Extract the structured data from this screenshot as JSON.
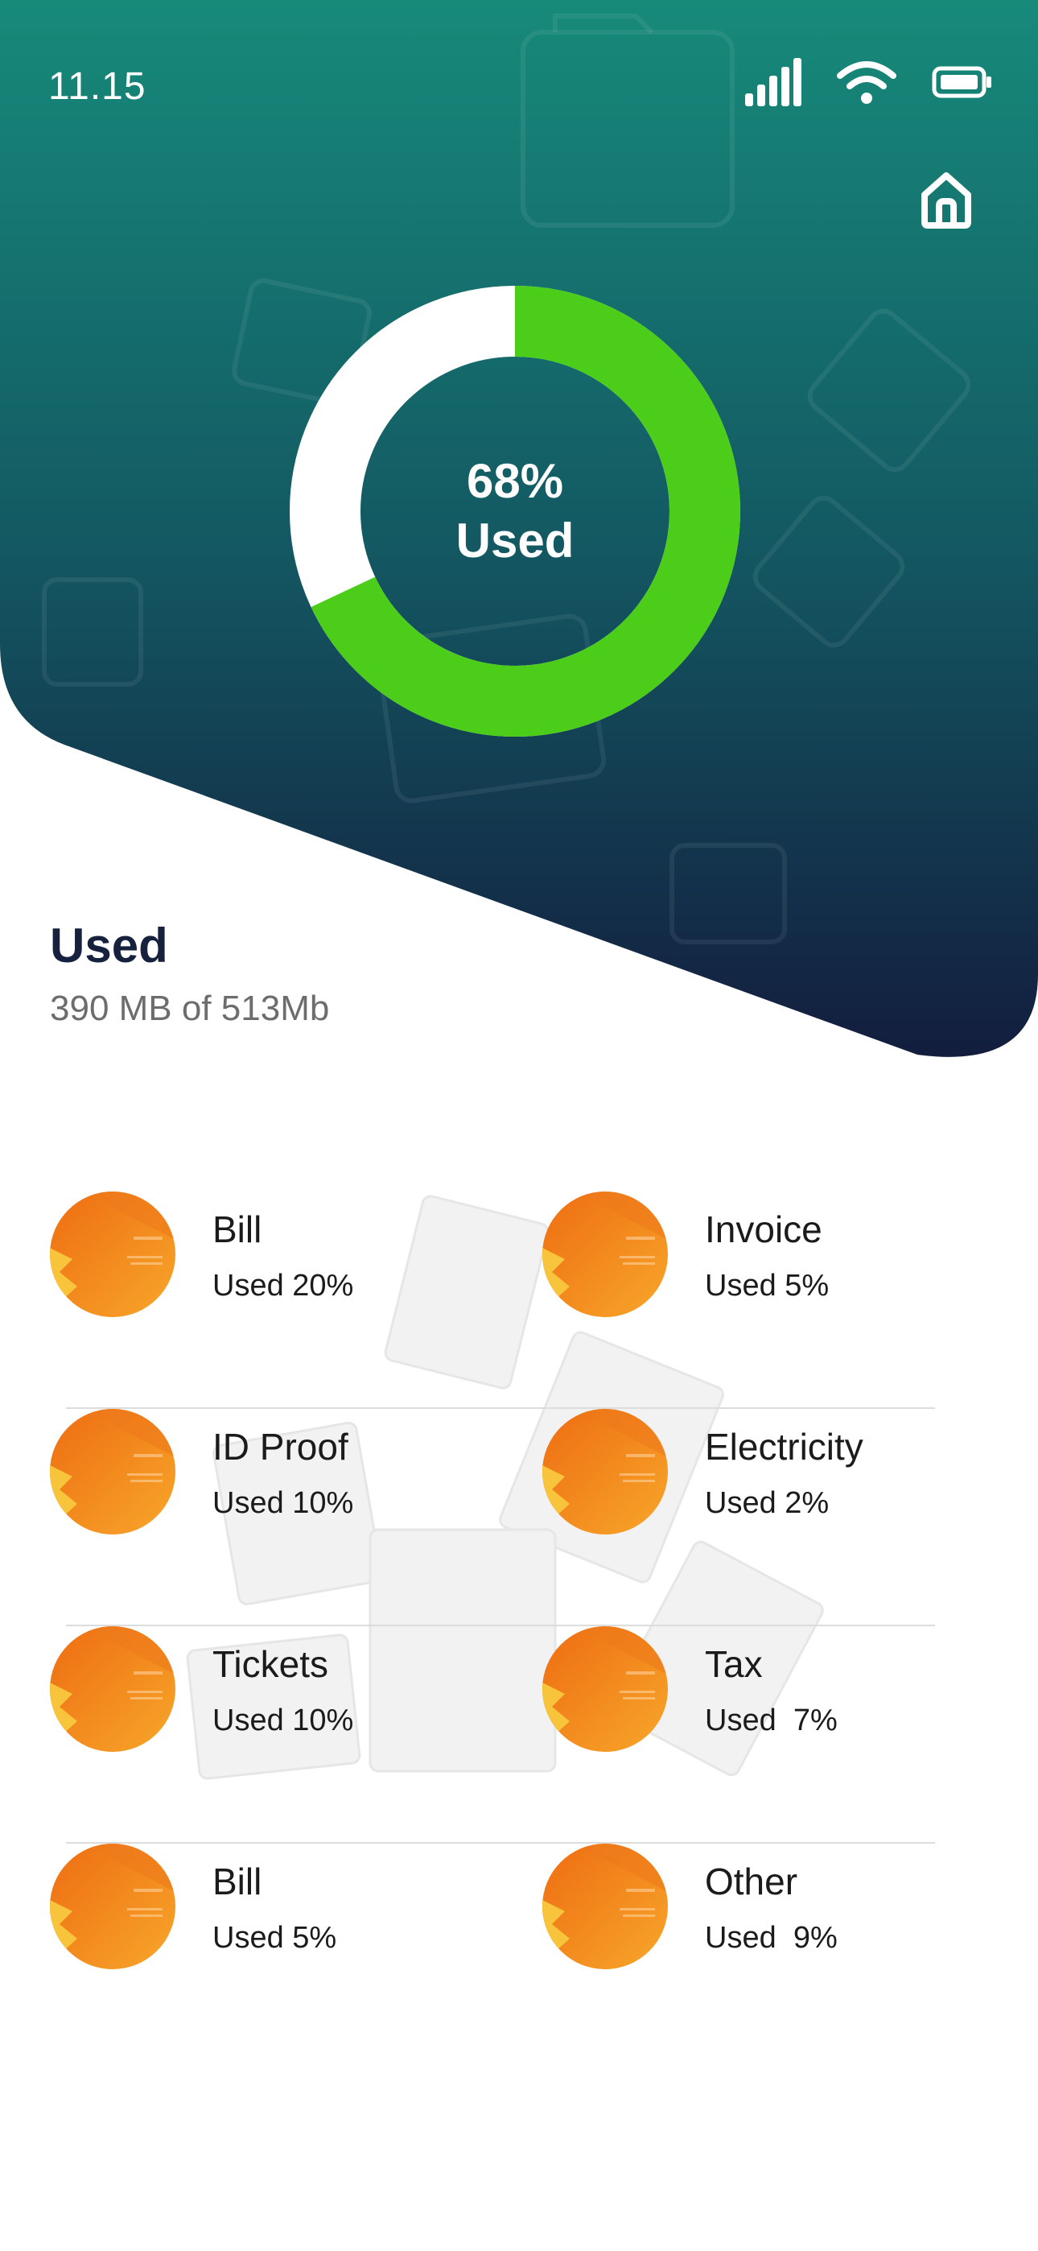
{
  "status_bar": {
    "time": "11.15",
    "icons": [
      "signal-icon",
      "wifi-icon",
      "battery-icon"
    ]
  },
  "header": {
    "home_icon": "home-icon",
    "colors": {
      "gradient_top": "#178a7a",
      "gradient_bottom": "#131d3e"
    }
  },
  "usage_chart": {
    "percent_label": "68%",
    "used_label": "Used",
    "used_fraction": 0.68,
    "used_color": "#4ccd1a",
    "free_color": "#ffffff"
  },
  "summary": {
    "title": "Used",
    "detail": "390 MB of 513Mb"
  },
  "categories": [
    {
      "name": "Bill",
      "usage": "Used 20%"
    },
    {
      "name": "Invoice",
      "usage": "Used 5%"
    },
    {
      "name": "ID Proof",
      "usage": "Used 10%"
    },
    {
      "name": "Electricity",
      "usage": "Used 2%"
    },
    {
      "name": "Tickets",
      "usage": "Used 10%"
    },
    {
      "name": "Tax",
      "usage": "Used  7%"
    },
    {
      "name": "Bill",
      "usage": "Used 5%"
    },
    {
      "name": "Other",
      "usage": "Used  9%"
    }
  ]
}
